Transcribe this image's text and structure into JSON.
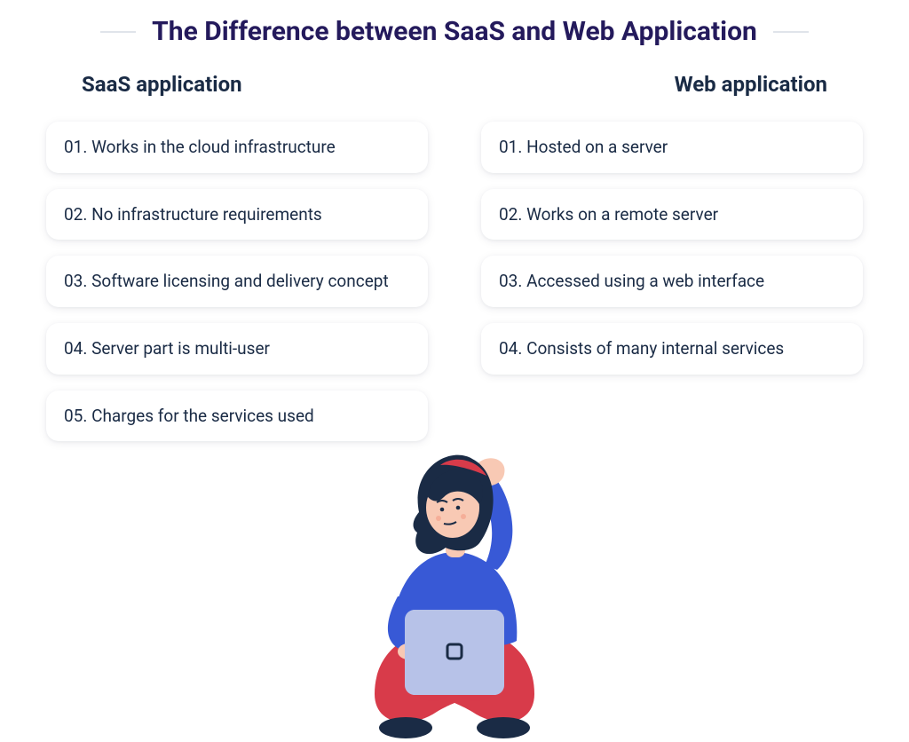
{
  "title": "The Difference between SaaS and Web Application",
  "columns": {
    "left": {
      "heading": "SaaS application",
      "items": [
        "01. Works in the cloud infrastructure",
        "02. No infrastructure requirements",
        "03. Software licensing and delivery concept",
        "04. Server part is multi-user",
        "05. Charges for the services used"
      ]
    },
    "right": {
      "heading": "Web application",
      "items": [
        "01. Hosted on a server",
        "02. Works on a remote server",
        "03. Accessed using a web interface",
        "04. Consists of many internal services"
      ]
    }
  },
  "illustration": {
    "skin": "#f8c9b4",
    "hair": "#1a2b45",
    "hair_accent": "#d83b4a",
    "shirt": "#3859d6",
    "pants": "#d83b4a",
    "shoes": "#1a2b45",
    "laptop_body": "#b7c2e8",
    "laptop_logo": "#1a2b45"
  }
}
